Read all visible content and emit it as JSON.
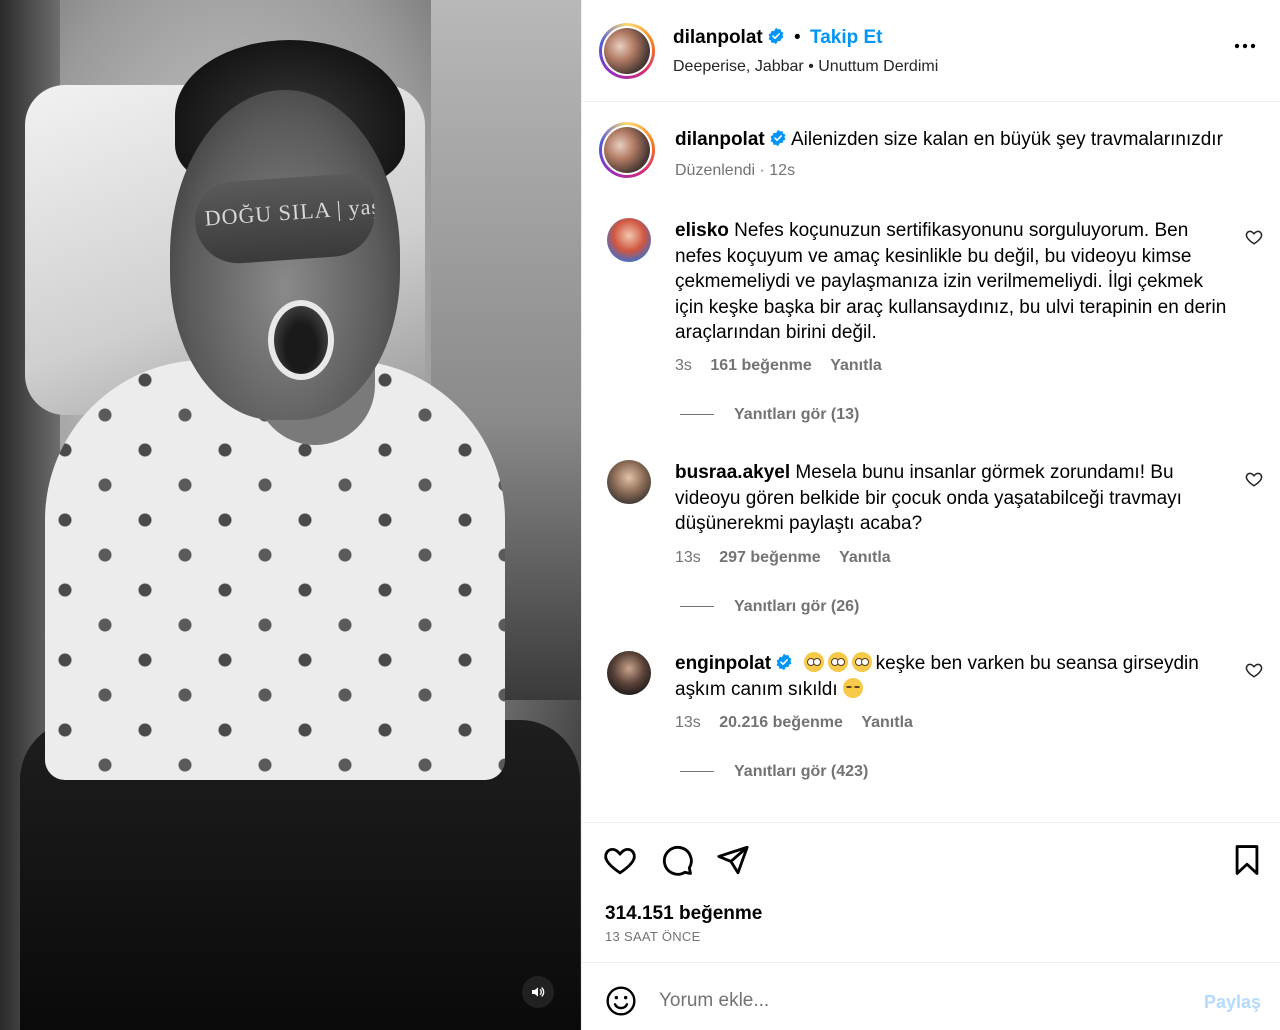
{
  "media": {
    "mask_text": "DOĞU SILA | yaşam merkezi",
    "sound_icon": "speaker-icon"
  },
  "header": {
    "username": "dilanpolat",
    "dot": "•",
    "follow_label": "Takip Et",
    "audio": "Deeperise, Jabbar • Unuttum Derdimi",
    "more_icon": "more-horizontal-icon"
  },
  "caption": {
    "username": "dilanpolat",
    "text": "Ailenizden size kalan en büyük şey travmalarınızdır",
    "edited": "Düzenlendi",
    "time": "12s"
  },
  "comments": [
    {
      "username": "elisko",
      "text": "Nefes koçunuzun sertifikasyonunu sorguluyorum. Ben nefes koçuyum ve amaç kesinlikle bu değil, bu videoyu kimse çekmemeliydi ve paylaşmanıza izin verilmemeliydi. İlgi çekmek için keşke başka bir araç kullansaydınız, bu ulvi terapinin en derin araçlarından birini değil.",
      "time": "3s",
      "likes": "161 beğenme",
      "reply": "Yanıtla",
      "view_replies": "Yanıtları gör (13)"
    },
    {
      "username": "busraa.akyel",
      "text": "Mesela bunu insanlar görmek zorundamı! Bu videoyu gören belkide bir çocuk onda yaşatabilceği travmayı düşünerekmi paylaştı acaba?",
      "time": "13s",
      "likes": "297 beğenme",
      "reply": "Yanıtla",
      "view_replies": "Yanıtları gör (26)"
    },
    {
      "username": "enginpolat",
      "text": "keşke ben varken bu seansa girseydin aşkım canım sıkıldı",
      "time": "13s",
      "likes": "20.216 beğenme",
      "reply": "Yanıtla",
      "view_replies": "Yanıtları gör (423)"
    }
  ],
  "actions": {
    "likes": "314.151 beğenme",
    "time": "13 SAAT ÖNCE"
  },
  "composer": {
    "placeholder": "Yorum ekle...",
    "share_label": "Paylaş"
  },
  "colors": {
    "accent": "#0095f6",
    "muted": "#737373",
    "share_disabled": "#b3dbff"
  }
}
